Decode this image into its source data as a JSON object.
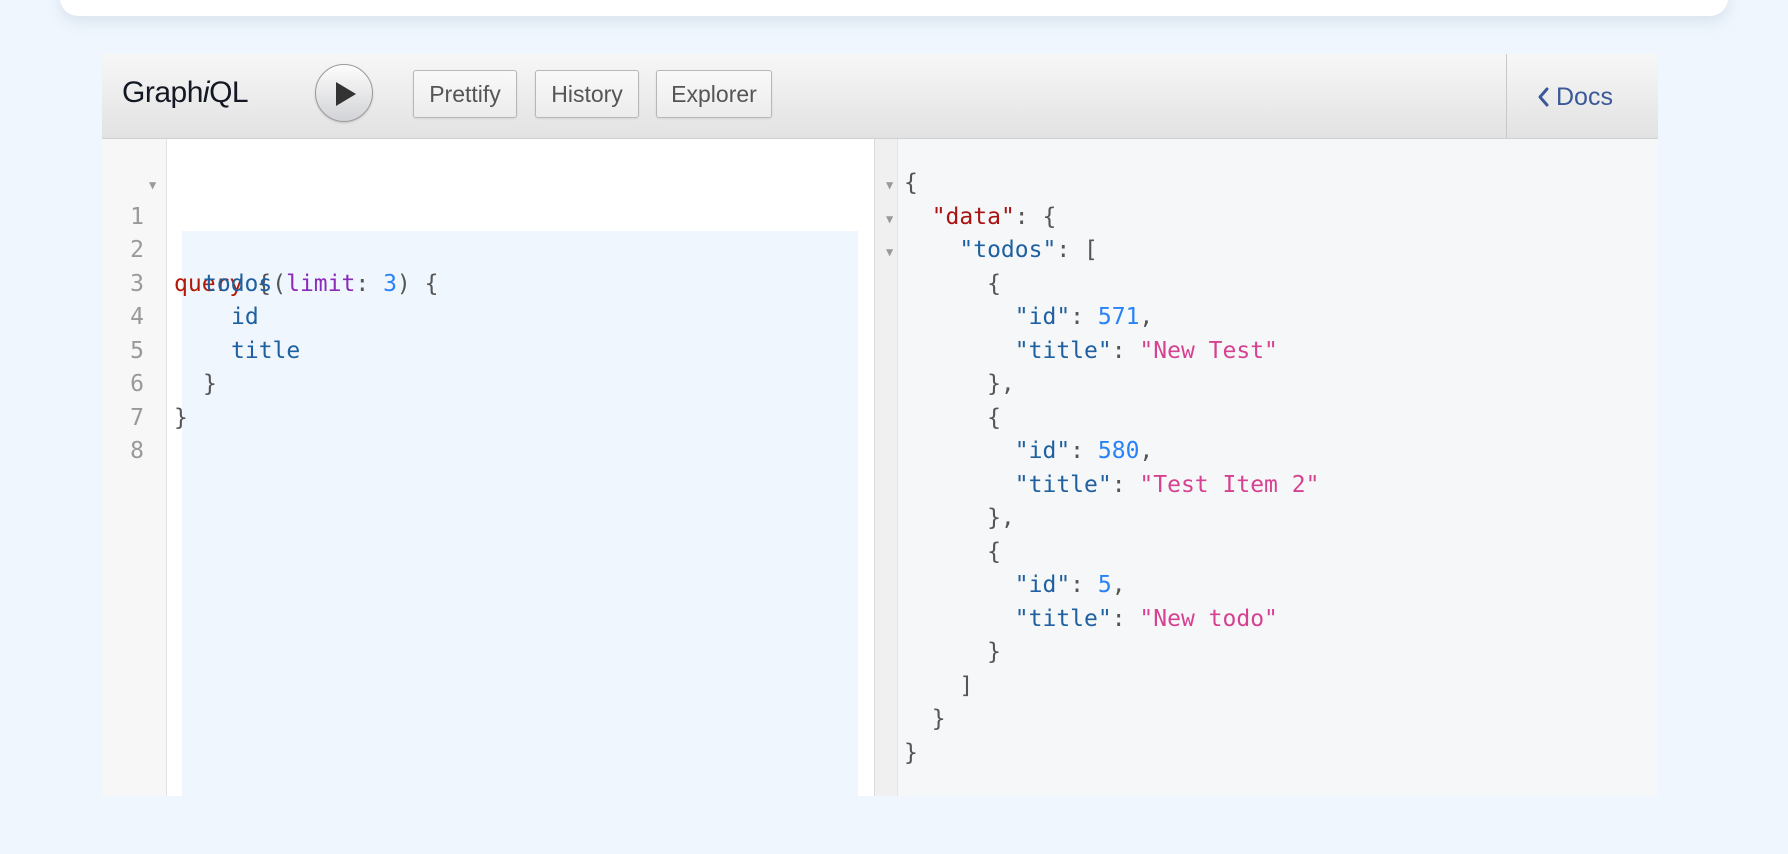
{
  "app": {
    "title_prefix": "Graph",
    "title_italic": "i",
    "title_suffix": "QL"
  },
  "toolbar": {
    "execute_icon": "play-icon",
    "prettify_label": "Prettify",
    "history_label": "History",
    "explorer_label": "Explorer",
    "docs_label": "Docs",
    "docs_icon": "chevron-left-icon"
  },
  "editor": {
    "line_numbers": [
      "1",
      "2",
      "3",
      "4",
      "5",
      "6",
      "7",
      "8"
    ],
    "tokens": {
      "query_kw": "query",
      "open_brace": " {",
      "todos_field": "todos",
      "paren_open": "(",
      "limit_arg": "limit",
      "colon": ": ",
      "limit_value": "3",
      "paren_close_brace": ") {",
      "id_field": "id",
      "title_field": "title",
      "close_brace": "}"
    }
  },
  "result": {
    "data_key": "\"data\"",
    "todos_key": "\"todos\"",
    "id_key": "\"id\"",
    "title_key": "\"title\"",
    "items": [
      {
        "id": "571",
        "title": "\"New Test\""
      },
      {
        "id": "580",
        "title": "\"Test Item 2\""
      },
      {
        "id": "5",
        "title": "\"New todo\""
      }
    ]
  },
  "colors": {
    "keyword": "#b11a04",
    "field": "#1f61a0",
    "argument": "#8b2bb9",
    "number": "#2882f9",
    "string": "#d64292",
    "docs_link": "#3b5998"
  }
}
